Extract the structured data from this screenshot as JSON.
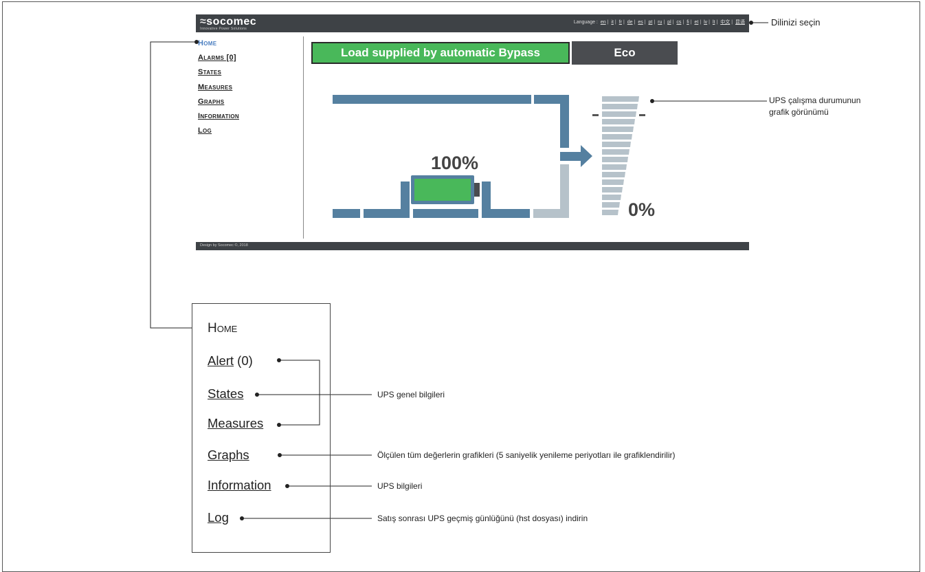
{
  "brand": {
    "logo_text": "socomec",
    "logo_mark": "≈",
    "tagline": "Innovative Power Solutions"
  },
  "language": {
    "label": "Language :",
    "options": [
      "en",
      "it",
      "fr",
      "de",
      "es",
      "pt",
      "ru",
      "pl",
      "cs",
      "fi",
      "et",
      "lv",
      "lt",
      "中文",
      "昆语"
    ]
  },
  "nav": {
    "home": "Home",
    "alarms": "Alarms [0]",
    "states": "States",
    "measures": "Measures",
    "graphs": "Graphs",
    "information": "Information",
    "log": "Log"
  },
  "status": {
    "mode": "Load supplied by automatic Bypass",
    "eco": "Eco"
  },
  "diagram": {
    "battery_level": "100%",
    "load_level": "0%",
    "load_scale_top": "-",
    "load_scale_right": "-"
  },
  "footer": {
    "text": "Design by Socomec ©, 2018"
  },
  "callouts": {
    "language": "Dilinizi seçin",
    "graphic_view_line1": "UPS çalışma durumunun",
    "graphic_view_line2": "grafik görünümü",
    "general_info": "UPS genel bilgileri",
    "graphs_info": "Ölçülen tüm değerlerin grafikleri (5 saniyelik yenileme periyotları ile grafiklendirilir)",
    "ups_info": "UPS bilgileri",
    "log_info": "Satış sonrası UPS geçmiş günlüğünü (hst dosyası) indirin"
  },
  "zoom": {
    "home": "Home",
    "alert": "Alert",
    "alert_count": " (0)",
    "states": "States",
    "measures": "Measures",
    "graphs": "Graphs",
    "information": "Information",
    "log": "Log"
  },
  "colors": {
    "header": "#3e4246",
    "pipe": "#5580a0",
    "pipe_light": "#b6c2ca",
    "battery": "#49b85a",
    "home_link": "#4a7ec0"
  }
}
